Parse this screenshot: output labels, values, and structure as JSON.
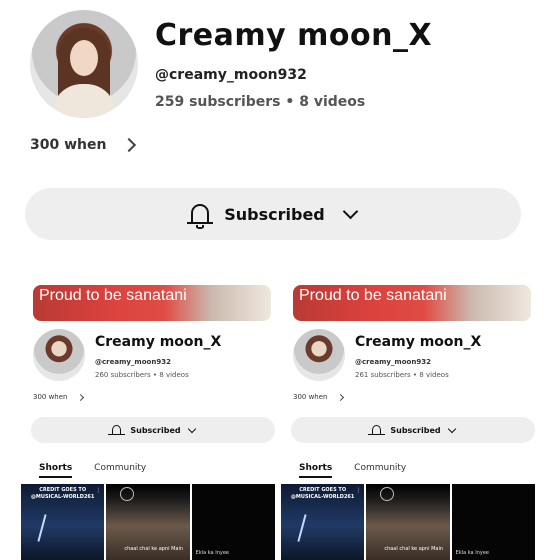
{
  "header": {
    "channel_name": "Creamy moon_X",
    "handle": "@creamy_moon932",
    "stats": "259 subscribers • 8 videos",
    "link_text": "300 when",
    "subscribe_label": "Subscribed"
  },
  "panels": [
    {
      "banner_text": "Proud to be sanatani",
      "channel_name": "Creamy moon_X",
      "handle": "@creamy_moon932",
      "stats": "260 subscribers • 8 videos",
      "link_text": "300 when",
      "subscribe_label": "Subscribed",
      "tabs": [
        "Shorts",
        "Community"
      ],
      "thumbs": {
        "t1_caption": "CREDIT GOES TO @MUSICAL-WORLD261",
        "t2_overlay": "chaal chal ke apni Main",
        "t3_overlay": "Ekla ka Inyee"
      }
    },
    {
      "banner_text": "Proud to be sanatani",
      "channel_name": "Creamy moon_X",
      "handle": "@creamy_moon932",
      "stats": "261 subscribers • 8 videos",
      "link_text": "300 when",
      "subscribe_label": "Subscribed",
      "tabs": [
        "Shorts",
        "Community"
      ],
      "thumbs": {
        "t1_caption": "CREDIT GOES TO @MUSICAL-WORLD261",
        "t2_overlay": "chaal chal ke apni Main",
        "t3_overlay": "Ekla ka Inyee"
      }
    }
  ]
}
